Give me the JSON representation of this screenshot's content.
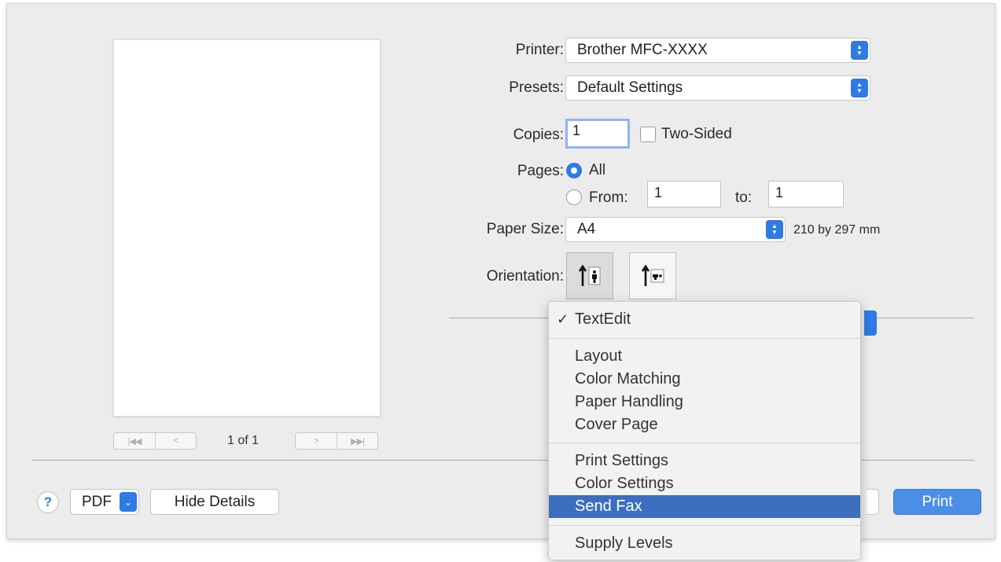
{
  "preview": {
    "page_indicator": "1 of 1",
    "first_page_icon": "|◀◀",
    "prev_page_icon": "<",
    "next_page_icon": ">",
    "last_page_icon": "▶▶|"
  },
  "printer": {
    "label": "Printer:",
    "value": "Brother MFC-XXXX"
  },
  "presets": {
    "label": "Presets:",
    "value": "Default Settings"
  },
  "copies": {
    "label": "Copies:",
    "value": "1",
    "two_sided_label": "Two-Sided",
    "two_sided_checked": false
  },
  "pages": {
    "label": "Pages:",
    "all_label": "All",
    "all_selected": true,
    "from_label": "From:",
    "from_value": "1",
    "to_label": "to:",
    "to_value": "1"
  },
  "paper_size": {
    "label": "Paper Size:",
    "value": "A4",
    "dimensions": "210 by 297 mm"
  },
  "orientation": {
    "label": "Orientation:",
    "selected": "portrait"
  },
  "app_menu": {
    "checked_item": "TextEdit",
    "check_mark": "✓",
    "groups": [
      [
        "Layout",
        "Color Matching",
        "Paper Handling",
        "Cover Page"
      ],
      [
        "Print Settings",
        "Color Settings",
        "Send Fax"
      ],
      [
        "Supply Levels"
      ]
    ],
    "highlighted": "Send Fax"
  },
  "footer": {
    "help_label": "?",
    "pdf_label": "PDF",
    "hide_details_label": "Hide Details",
    "print_label": "Print"
  },
  "colors": {
    "accent": "#2f7ae5",
    "menu_highlight": "#3c6ec0",
    "dialog_bg": "#ececec"
  }
}
